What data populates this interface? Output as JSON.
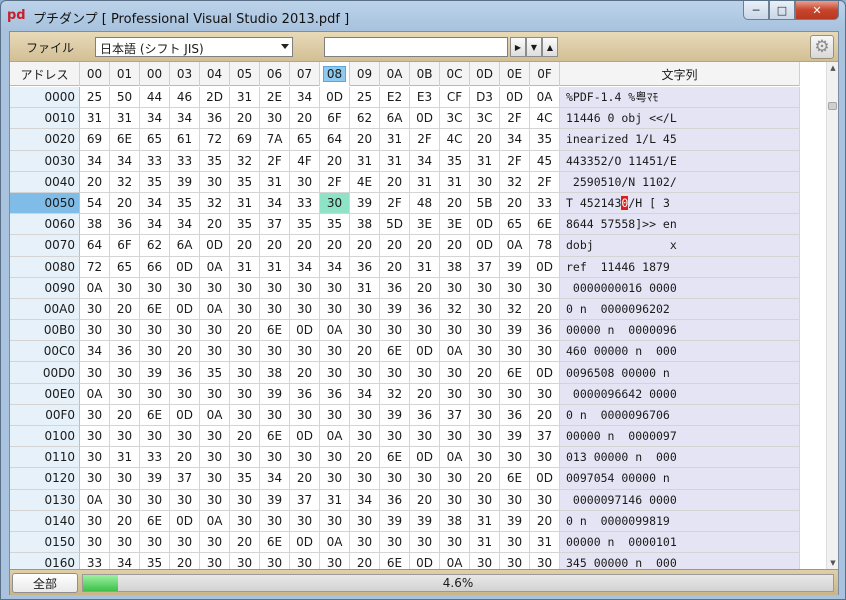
{
  "window": {
    "app_icon": "pd",
    "title": "プチダンプ [ Professional Visual Studio 2013.pdf ]",
    "minimize": "─",
    "maximize": "□",
    "close": "✕"
  },
  "toolbar": {
    "file_label": "ファイル",
    "encoding_value": "日本語 (シフト JIS)",
    "search_value": "",
    "next_icon": "▶",
    "down_icon": "▼",
    "up_icon": "▲",
    "gear_icon": "⚙"
  },
  "grid": {
    "address_header": "アドレス",
    "text_header": "文字列",
    "byte_headers": [
      "00",
      "01",
      "00",
      "03",
      "04",
      "05",
      "06",
      "07",
      "08",
      "09",
      "0A",
      "0B",
      "0C",
      "0D",
      "0E",
      "0F"
    ],
    "active_column": 8,
    "selected_row": 5,
    "rows": [
      {
        "addr": "0000",
        "bytes": [
          "25",
          "50",
          "44",
          "46",
          "2D",
          "31",
          "2E",
          "34",
          "0D",
          "25",
          "E2",
          "E3",
          "CF",
          "D3",
          "0D",
          "0A"
        ],
        "text": "%PDF-1.4 %粤ﾏﾓ"
      },
      {
        "addr": "0010",
        "bytes": [
          "31",
          "31",
          "34",
          "34",
          "36",
          "20",
          "30",
          "20",
          "6F",
          "62",
          "6A",
          "0D",
          "3C",
          "3C",
          "2F",
          "4C"
        ],
        "text": "11446 0 obj <</L"
      },
      {
        "addr": "0020",
        "bytes": [
          "69",
          "6E",
          "65",
          "61",
          "72",
          "69",
          "7A",
          "65",
          "64",
          "20",
          "31",
          "2F",
          "4C",
          "20",
          "34",
          "35"
        ],
        "text": "inearized 1/L 45"
      },
      {
        "addr": "0030",
        "bytes": [
          "34",
          "34",
          "33",
          "33",
          "35",
          "32",
          "2F",
          "4F",
          "20",
          "31",
          "31",
          "34",
          "35",
          "31",
          "2F",
          "45"
        ],
        "text": "443352/O 11451/E"
      },
      {
        "addr": "0040",
        "bytes": [
          "20",
          "32",
          "35",
          "39",
          "30",
          "35",
          "31",
          "30",
          "2F",
          "4E",
          "20",
          "31",
          "31",
          "30",
          "32",
          "2F"
        ],
        "text": " 2590510/N 1102/"
      },
      {
        "addr": "0050",
        "bytes": [
          "54",
          "20",
          "34",
          "35",
          "32",
          "31",
          "34",
          "33",
          "30",
          "39",
          "2F",
          "48",
          "20",
          "5B",
          "20",
          "33"
        ],
        "text": "T 4521430/H [ 3"
      },
      {
        "addr": "0060",
        "bytes": [
          "38",
          "36",
          "34",
          "34",
          "20",
          "35",
          "37",
          "35",
          "35",
          "38",
          "5D",
          "3E",
          "3E",
          "0D",
          "65",
          "6E"
        ],
        "text": "8644 57558]>> en"
      },
      {
        "addr": "0070",
        "bytes": [
          "64",
          "6F",
          "62",
          "6A",
          "0D",
          "20",
          "20",
          "20",
          "20",
          "20",
          "20",
          "20",
          "20",
          "0D",
          "0A",
          "78"
        ],
        "text": "dobj           x"
      },
      {
        "addr": "0080",
        "bytes": [
          "72",
          "65",
          "66",
          "0D",
          "0A",
          "31",
          "31",
          "34",
          "34",
          "36",
          "20",
          "31",
          "38",
          "37",
          "39",
          "0D"
        ],
        "text": "ref  11446 1879"
      },
      {
        "addr": "0090",
        "bytes": [
          "0A",
          "30",
          "30",
          "30",
          "30",
          "30",
          "30",
          "30",
          "30",
          "31",
          "36",
          "20",
          "30",
          "30",
          "30",
          "30"
        ],
        "text": " 0000000016 0000"
      },
      {
        "addr": "00A0",
        "bytes": [
          "30",
          "20",
          "6E",
          "0D",
          "0A",
          "30",
          "30",
          "30",
          "30",
          "30",
          "39",
          "36",
          "32",
          "30",
          "32",
          "20"
        ],
        "text": "0 n  0000096202"
      },
      {
        "addr": "00B0",
        "bytes": [
          "30",
          "30",
          "30",
          "30",
          "30",
          "20",
          "6E",
          "0D",
          "0A",
          "30",
          "30",
          "30",
          "30",
          "30",
          "39",
          "36"
        ],
        "text": "00000 n  0000096"
      },
      {
        "addr": "00C0",
        "bytes": [
          "34",
          "36",
          "30",
          "20",
          "30",
          "30",
          "30",
          "30",
          "30",
          "20",
          "6E",
          "0D",
          "0A",
          "30",
          "30",
          "30"
        ],
        "text": "460 00000 n  000"
      },
      {
        "addr": "00D0",
        "bytes": [
          "30",
          "30",
          "39",
          "36",
          "35",
          "30",
          "38",
          "20",
          "30",
          "30",
          "30",
          "30",
          "30",
          "20",
          "6E",
          "0D"
        ],
        "text": "0096508 00000 n"
      },
      {
        "addr": "00E0",
        "bytes": [
          "0A",
          "30",
          "30",
          "30",
          "30",
          "30",
          "39",
          "36",
          "36",
          "34",
          "32",
          "20",
          "30",
          "30",
          "30",
          "30"
        ],
        "text": " 0000096642 0000"
      },
      {
        "addr": "00F0",
        "bytes": [
          "30",
          "20",
          "6E",
          "0D",
          "0A",
          "30",
          "30",
          "30",
          "30",
          "30",
          "39",
          "36",
          "37",
          "30",
          "36",
          "20"
        ],
        "text": "0 n  0000096706"
      },
      {
        "addr": "0100",
        "bytes": [
          "30",
          "30",
          "30",
          "30",
          "30",
          "20",
          "6E",
          "0D",
          "0A",
          "30",
          "30",
          "30",
          "30",
          "30",
          "39",
          "37"
        ],
        "text": "00000 n  0000097"
      },
      {
        "addr": "0110",
        "bytes": [
          "30",
          "31",
          "33",
          "20",
          "30",
          "30",
          "30",
          "30",
          "30",
          "20",
          "6E",
          "0D",
          "0A",
          "30",
          "30",
          "30"
        ],
        "text": "013 00000 n  000"
      },
      {
        "addr": "0120",
        "bytes": [
          "30",
          "30",
          "39",
          "37",
          "30",
          "35",
          "34",
          "20",
          "30",
          "30",
          "30",
          "30",
          "30",
          "20",
          "6E",
          "0D"
        ],
        "text": "0097054 00000 n"
      },
      {
        "addr": "0130",
        "bytes": [
          "0A",
          "30",
          "30",
          "30",
          "30",
          "30",
          "39",
          "37",
          "31",
          "34",
          "36",
          "20",
          "30",
          "30",
          "30",
          "30"
        ],
        "text": " 0000097146 0000"
      },
      {
        "addr": "0140",
        "bytes": [
          "30",
          "20",
          "6E",
          "0D",
          "0A",
          "30",
          "30",
          "30",
          "30",
          "30",
          "39",
          "39",
          "38",
          "31",
          "39",
          "20"
        ],
        "text": "0 n  0000099819"
      },
      {
        "addr": "0150",
        "bytes": [
          "30",
          "30",
          "30",
          "30",
          "30",
          "20",
          "6E",
          "0D",
          "0A",
          "30",
          "30",
          "30",
          "30",
          "31",
          "30",
          "31"
        ],
        "text": "00000 n  0000101"
      },
      {
        "addr": "0160",
        "bytes": [
          "33",
          "34",
          "35",
          "20",
          "30",
          "30",
          "30",
          "30",
          "30",
          "20",
          "6E",
          "0D",
          "0A",
          "30",
          "30",
          "30"
        ],
        "text": "345 00000 n  000"
      }
    ]
  },
  "status": {
    "all_button": "全部",
    "progress_text": "4.6%",
    "progress_fraction": 0.046
  }
}
